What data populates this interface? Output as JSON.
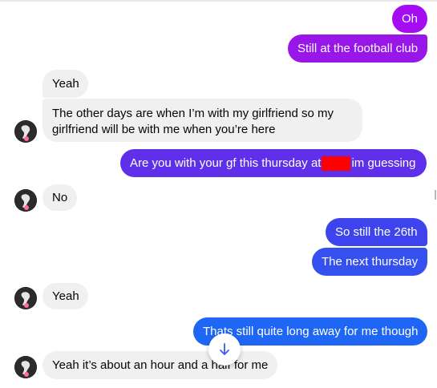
{
  "messages": {
    "m1": "Oh",
    "m2": "Still at the football club",
    "m3": "Yeah",
    "m4": "The other days are when I’m with my girlfriend so my girlfriend will be with me when you’re here",
    "m5_before": "Are you with your gf this thursday at",
    "m5_after": "im guessing",
    "m6": "No",
    "m7": "So still the 26th",
    "m8": "The next thursday",
    "m9": "Yeah",
    "m10": "Thats still quite long away for me though",
    "m11": "Yeah it’s about an hour and a half for me"
  },
  "colors": {
    "incoming_bg": "#f0f0f0",
    "outgoing_gradient": [
      "#a50cf2",
      "#9816e8",
      "#5f2fea",
      "#3d44ee",
      "#3450ef",
      "#1f66f4"
    ],
    "redaction": "#ff0000"
  },
  "icons": {
    "avatar": "contact-avatar",
    "scroll_down": "arrow-down-icon"
  }
}
